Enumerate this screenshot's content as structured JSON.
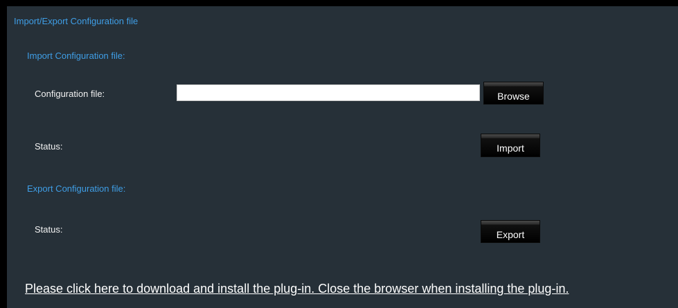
{
  "panel": {
    "title": "Import/Export Configuration file"
  },
  "import_section": {
    "heading": "Import Configuration file:",
    "file_label": "Configuration file:",
    "file_value": "",
    "browse_label": "Browse",
    "status_label": "Status:",
    "import_label": "Import"
  },
  "export_section": {
    "heading": "Export Configuration file:",
    "status_label": "Status:",
    "export_label": "Export"
  },
  "plugin_notice": "Please click here to download and install the plug-in. Close the browser when installing the plug-in.",
  "colors": {
    "page_background": "#000000",
    "panel_background": "#263038",
    "heading_blue": "#3f9ee6",
    "label_white": "#f2f2f2"
  }
}
